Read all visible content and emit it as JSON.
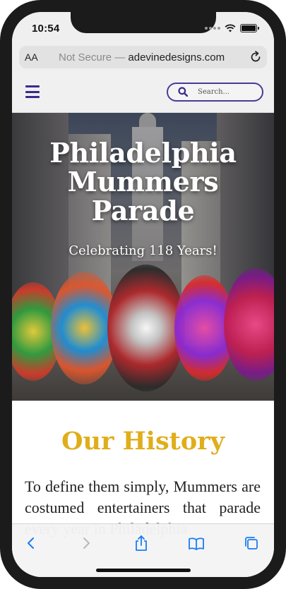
{
  "status_bar": {
    "time": "10:54"
  },
  "browser": {
    "text_size_label": "AA",
    "security_label": "Not Secure",
    "separator": " — ",
    "host": "adevinedesigns.com"
  },
  "site_header": {
    "search_placeholder": "Search..."
  },
  "hero": {
    "title_line1": "Philadelphia",
    "title_line2": "Mummers",
    "title_line3": "Parade",
    "subtitle": "Celebrating 118 Years!"
  },
  "history": {
    "heading": "Our History",
    "paragraph": "To define them simply, Mummers are costumed entertainers that parade every year in Philadelphia"
  },
  "colors": {
    "accent_purple": "#3c2a8a",
    "heading_gold": "#e0ae1b",
    "ios_blue": "#1a7cf5"
  },
  "icons": {
    "menu": "hamburger-icon",
    "search": "search-icon",
    "reload": "reload-icon",
    "back": "chevron-left-icon",
    "forward": "chevron-right-icon",
    "share": "share-icon",
    "bookmarks": "book-icon",
    "tabs": "tabs-icon"
  }
}
